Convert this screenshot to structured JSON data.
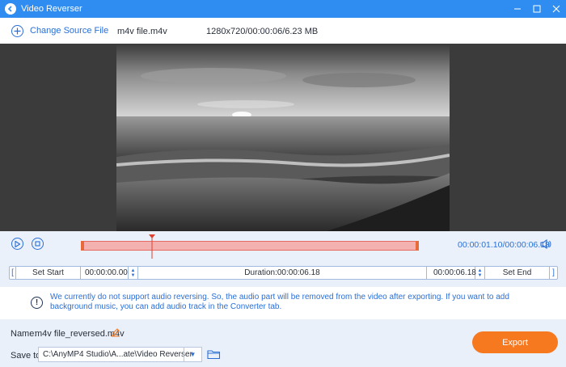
{
  "window": {
    "title": "Video Reverser"
  },
  "source": {
    "change_label": "Change Source File",
    "file_name": "m4v file.m4v",
    "file_meta": "1280x720/00:00:06/6.23 MB"
  },
  "playback": {
    "current_time": "00:00:01.10",
    "total_time": "00:00:06.18",
    "playhead_fraction": 0.21,
    "selection": [
      0.0,
      1.0
    ]
  },
  "range": {
    "set_start_label": "Set Start",
    "start_value": "00:00:00.00",
    "duration_text": "Duration:00:00:06.18",
    "end_value": "00:00:06.18",
    "set_end_label": "Set End"
  },
  "notice": {
    "message": "We currently do not support audio reversing. So, the audio part will be removed from the video after exporting. If you want to add background music, you can add audio track in the Converter tab."
  },
  "output": {
    "name_label": "Name:",
    "name_value": "m4v file_reversed.m4v",
    "save_label": "Save to:",
    "save_path": "C:\\AnyMP4 Studio\\A...ate\\Video Reverser",
    "export_label": "Export"
  },
  "colors": {
    "accent": "#2f8cf0",
    "export": "#f6781f",
    "trim": "#f3b2b0"
  }
}
